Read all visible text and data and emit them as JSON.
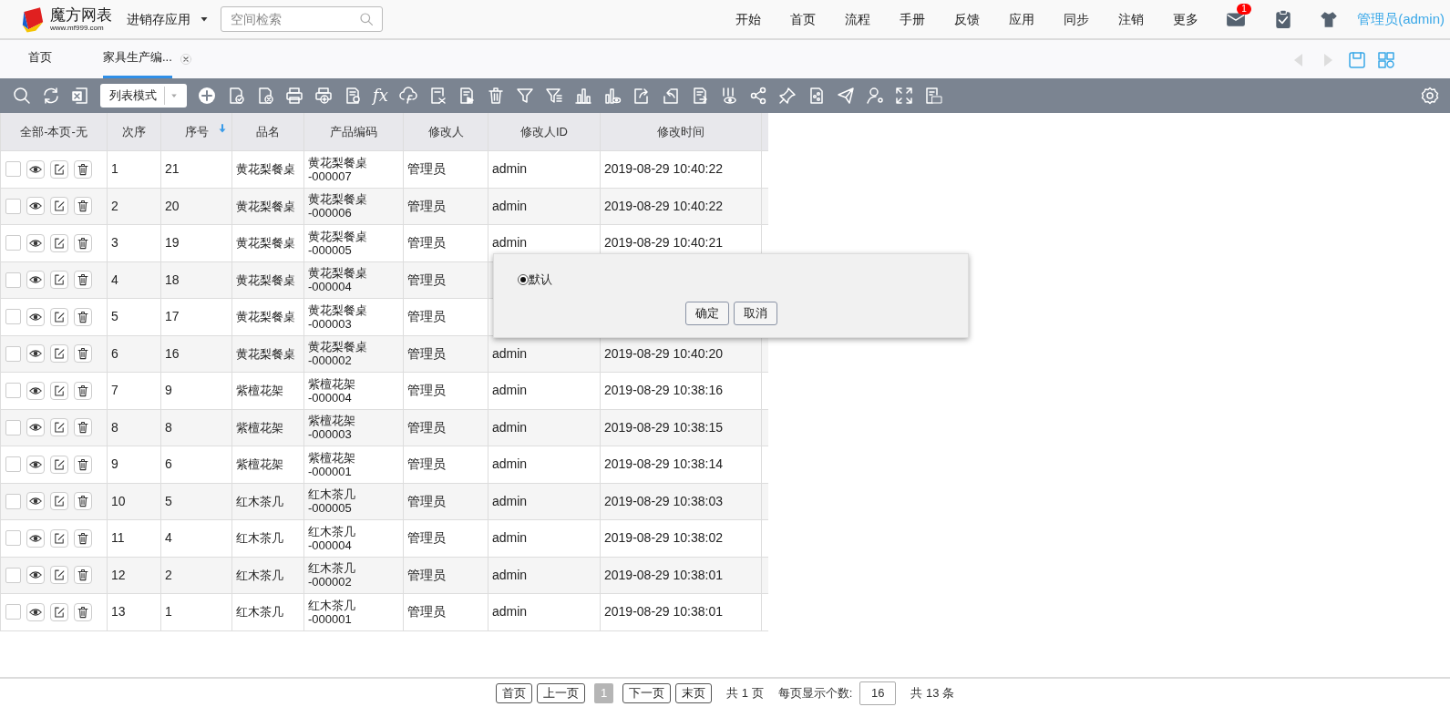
{
  "header": {
    "logo_name": "魔方网表",
    "logo_url": "www.mf999.com",
    "app_menu": "进销存应用",
    "search": {
      "placeholder": "空间检索"
    },
    "nav": [
      "开始",
      "首页",
      "流程",
      "手册",
      "反馈",
      "应用",
      "同步",
      "注销",
      "更多"
    ],
    "mail_badge": "1",
    "user": "管理员(admin)"
  },
  "tabs": [
    {
      "label": "首页",
      "selected": false,
      "closable": false
    },
    {
      "label": "家具生产编...",
      "selected": true,
      "closable": true
    }
  ],
  "toolbar": {
    "view_mode": "列表模式",
    "formula": "fx"
  },
  "table": {
    "select_links": "全部-本页-无",
    "columns": [
      {
        "label": "次序",
        "sorted": false
      },
      {
        "label": "序号",
        "sorted": true
      },
      {
        "label": "品名",
        "sorted": false
      },
      {
        "label": "产品编码",
        "sorted": false
      },
      {
        "label": "修改人",
        "sorted": false
      },
      {
        "label": "修改人ID",
        "sorted": false
      },
      {
        "label": "修改时间",
        "sorted": false
      }
    ],
    "rows": [
      {
        "checked": false,
        "cells": [
          "1",
          "21",
          "黄花梨餐桌",
          "黄花梨餐桌\n-000007",
          "管理员",
          "admin",
          "2019-08-29 10:40:22"
        ]
      },
      {
        "checked": false,
        "cells": [
          "2",
          "20",
          "黄花梨餐桌",
          "黄花梨餐桌\n-000006",
          "管理员",
          "admin",
          "2019-08-29 10:40:22"
        ]
      },
      {
        "checked": false,
        "cells": [
          "3",
          "19",
          "黄花梨餐桌",
          "黄花梨餐桌\n-000005",
          "管理员",
          "admin",
          "2019-08-29 10:40:21"
        ]
      },
      {
        "checked": false,
        "cells": [
          "4",
          "18",
          "黄花梨餐桌",
          "黄花梨餐桌\n-000004",
          "管理员"
        ]
      },
      {
        "checked": false,
        "cells": [
          "5",
          "17",
          "黄花梨餐桌",
          "黄花梨餐桌\n-000003",
          "管理员"
        ]
      },
      {
        "checked": false,
        "cells": [
          "6",
          "16",
          "黄花梨餐桌",
          "黄花梨餐桌\n-000002",
          "管理员",
          "admin",
          "2019-08-29 10:40:20"
        ]
      },
      {
        "checked": false,
        "cells": [
          "7",
          "9",
          "紫檀花架",
          "紫檀花架\n-000004",
          "管理员",
          "admin",
          "2019-08-29 10:38:16"
        ]
      },
      {
        "checked": false,
        "cells": [
          "8",
          "8",
          "紫檀花架",
          "紫檀花架\n-000003",
          "管理员",
          "admin",
          "2019-08-29 10:38:15"
        ]
      },
      {
        "checked": false,
        "cells": [
          "9",
          "6",
          "紫檀花架",
          "紫檀花架\n-000001",
          "管理员",
          "admin",
          "2019-08-29 10:38:14"
        ]
      },
      {
        "checked": false,
        "cells": [
          "10",
          "5",
          "红木茶几",
          "红木茶几\n-000005",
          "管理员",
          "admin",
          "2019-08-29 10:38:03"
        ]
      },
      {
        "checked": false,
        "cells": [
          "11",
          "4",
          "红木茶几",
          "红木茶几\n-000004",
          "管理员",
          "admin",
          "2019-08-29 10:38:02"
        ]
      },
      {
        "checked": false,
        "cells": [
          "12",
          "2",
          "红木茶几",
          "红木茶几\n-000002",
          "管理员",
          "admin",
          "2019-08-29 10:38:01"
        ]
      },
      {
        "checked": false,
        "cells": [
          "13",
          "1",
          "红木茶几",
          "红木茶几\n-000001",
          "管理员",
          "admin",
          "2019-08-29 10:38:01"
        ]
      }
    ]
  },
  "dialog": {
    "options": [
      {
        "label": "默认",
        "selected": true
      }
    ],
    "buttons": [
      "确定",
      "取消"
    ]
  },
  "pagination": {
    "buttons": [
      "首页",
      "上一页"
    ],
    "current_page": "1",
    "next_buttons": [
      "下一页",
      "末页"
    ],
    "total_pages": "共 1 页",
    "page_size_label": "每页显示个数:",
    "page_size": "16",
    "total_records": "共 13 条"
  }
}
